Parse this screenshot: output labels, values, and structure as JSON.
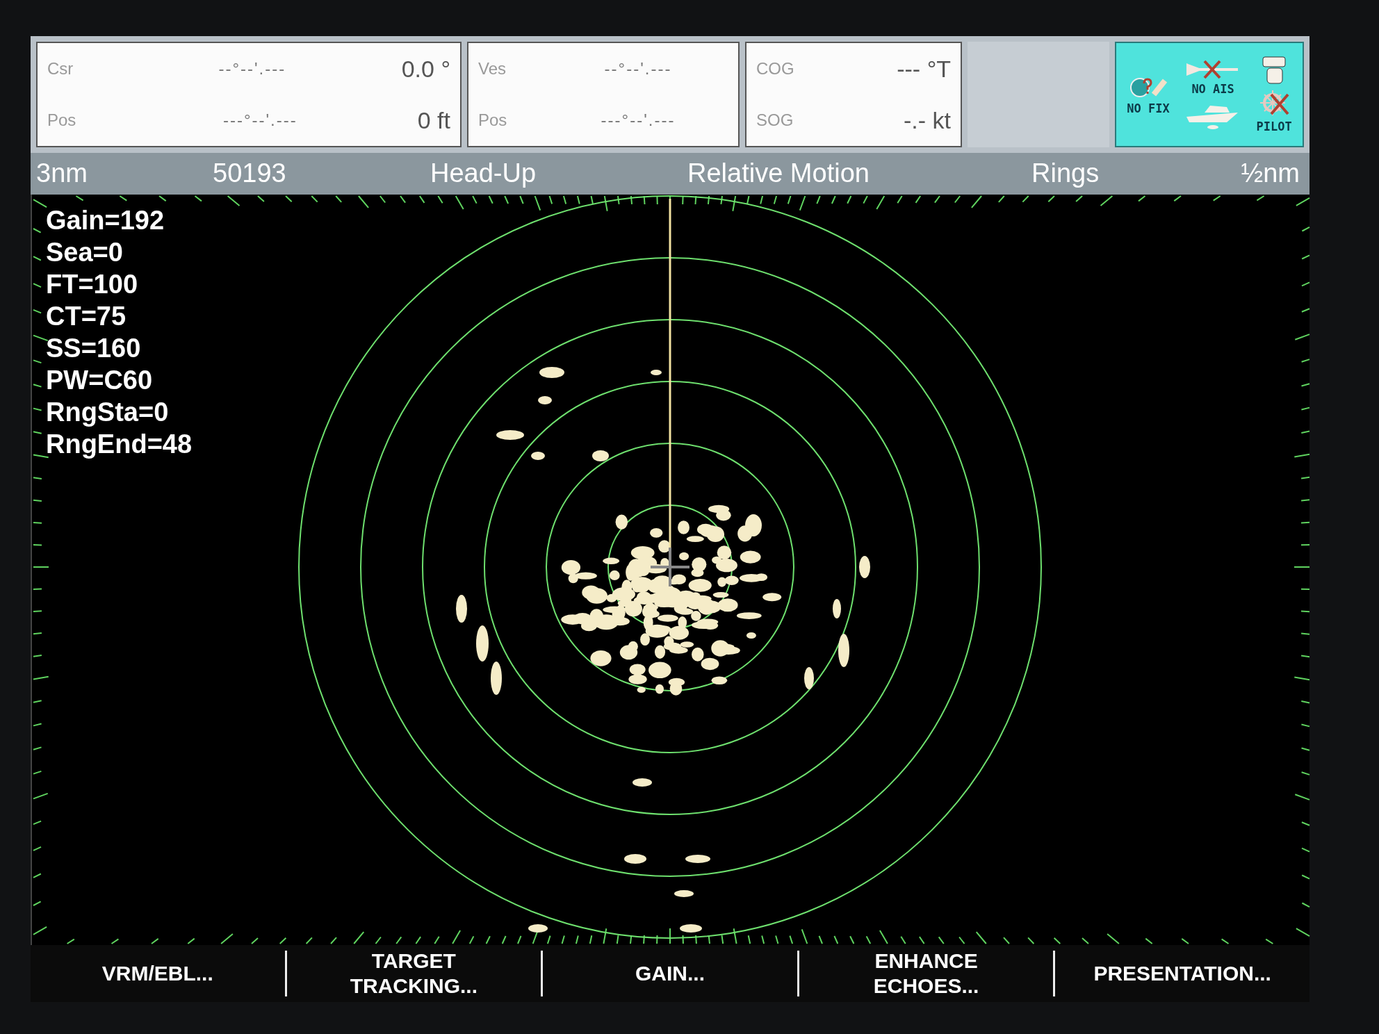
{
  "info_boxes": [
    {
      "rows": [
        {
          "label": "Csr",
          "coord": "--°--'.---",
          "value": "0.0 °"
        },
        {
          "label": "Pos",
          "coord": "---°--'.---",
          "value": "0 ft"
        }
      ]
    },
    {
      "rows": [
        {
          "label": "Ves",
          "coord": "--°--'.---"
        },
        {
          "label": "Pos",
          "coord": "---°--'.---"
        }
      ]
    },
    {
      "rows": [
        {
          "label": "COG",
          "value": "--- °T"
        },
        {
          "label": "SOG",
          "value": "-.- kt"
        }
      ]
    }
  ],
  "status_icons": {
    "fix": "NO FIX",
    "ais": "NO AIS",
    "pilot": "PILOT"
  },
  "status_bar": [
    "3nm",
    "50193",
    "Head-Up",
    "Relative Motion",
    "Rings",
    "½nm"
  ],
  "radar_readouts": [
    "Gain=192",
    "Sea=0",
    "FT=100",
    "CT=75",
    "SS=160",
    "PW=C60",
    "RngSta=0",
    "RngEnd=48"
  ],
  "softkeys": [
    [
      "VRM/EBL..."
    ],
    [
      "TARGET",
      "TRACKING..."
    ],
    [
      "GAIN..."
    ],
    [
      "ENHANCE",
      "ECHOES..."
    ],
    [
      "PRESENTATION..."
    ]
  ]
}
